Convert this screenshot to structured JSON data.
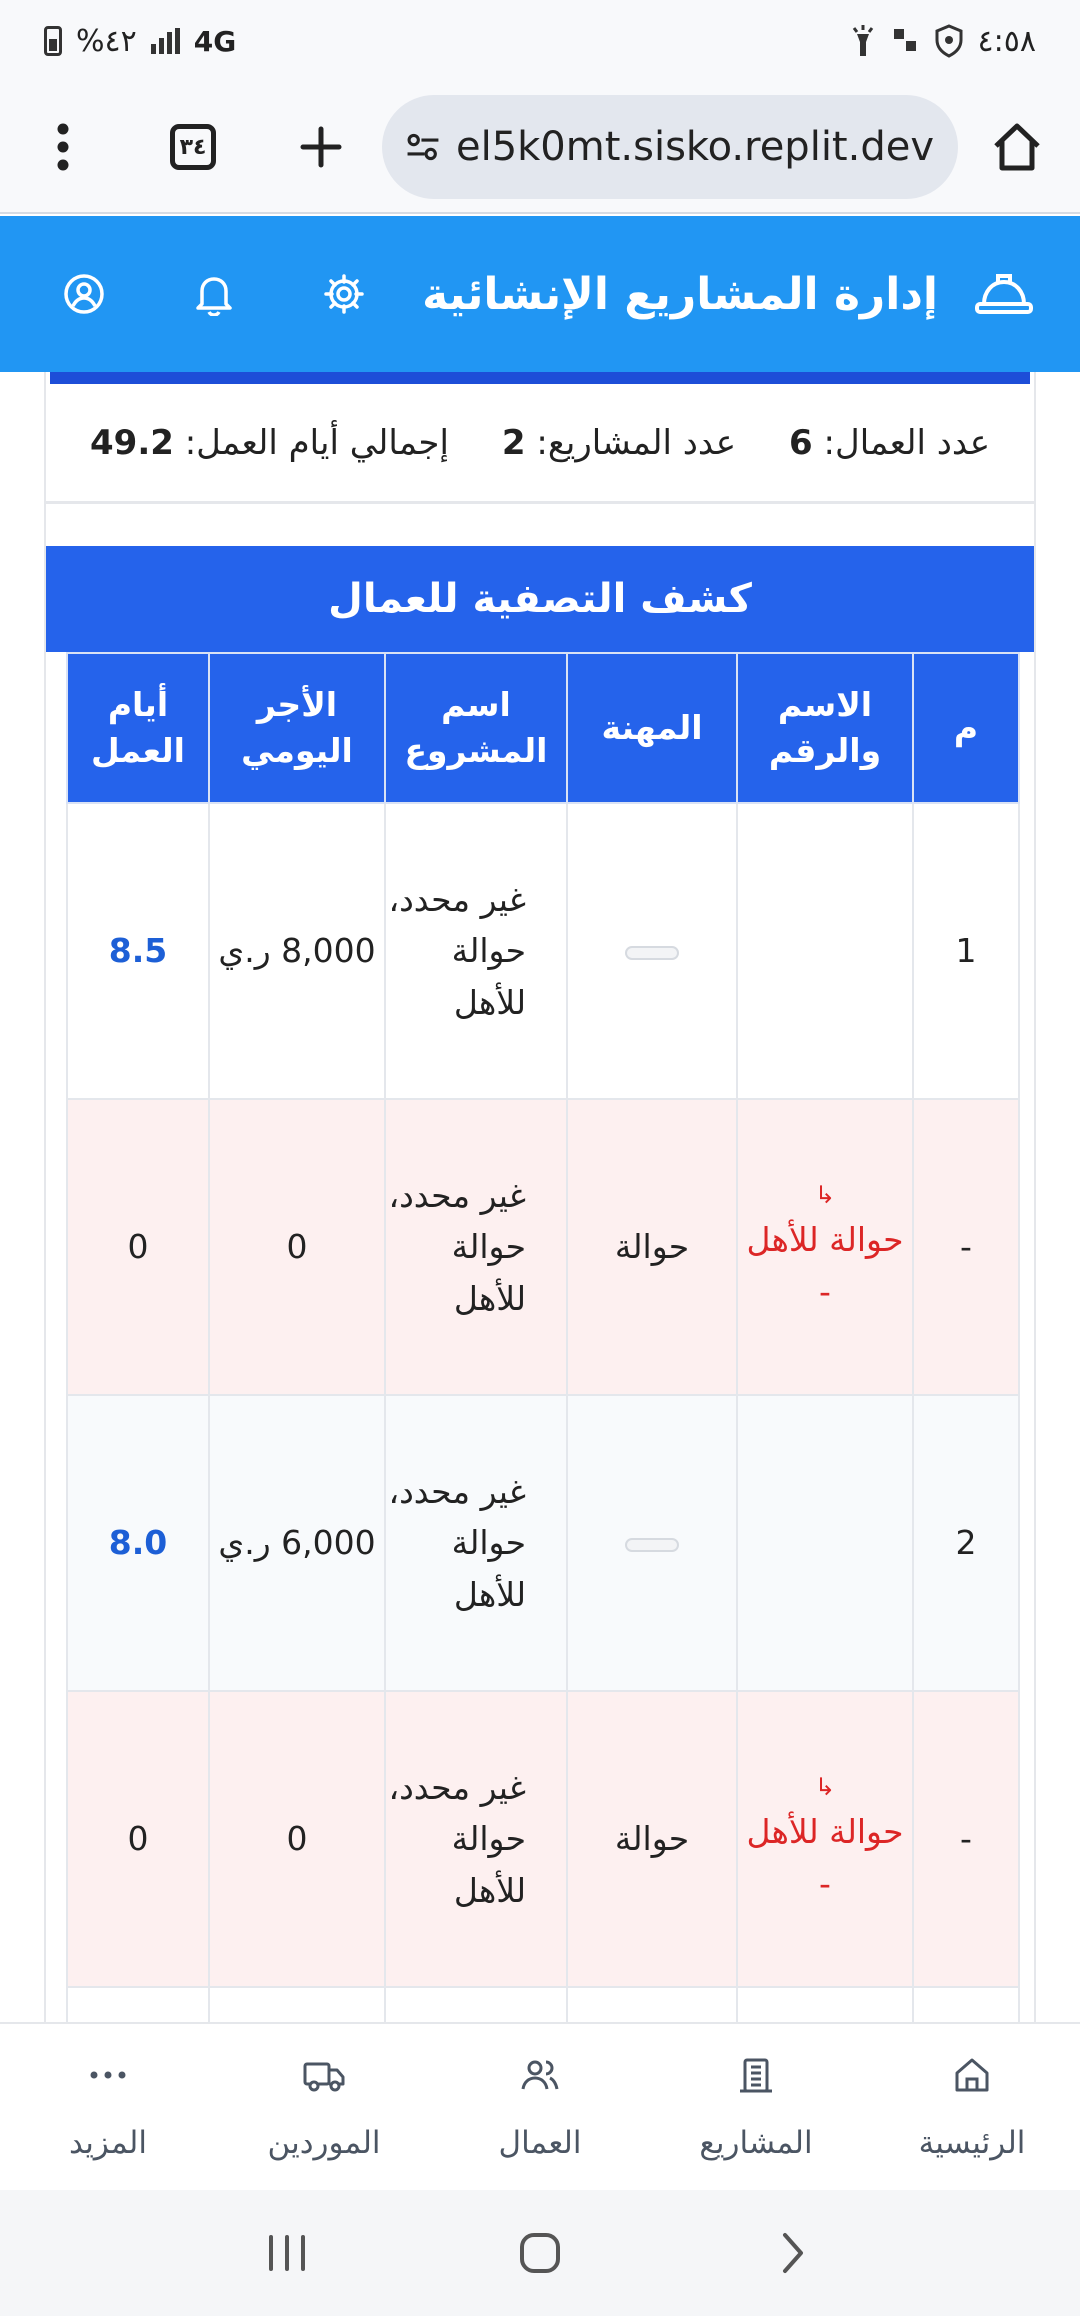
{
  "status_bar": {
    "time": "٤:٥٨",
    "battery": "%٤٢",
    "network": "4G"
  },
  "browser": {
    "url": "el5k0mt.sisko.replit.dev",
    "tab_count": "٣٤"
  },
  "header": {
    "title": "إدارة المشاريع الإنشائية",
    "brand_color": "#2196f3"
  },
  "summary": {
    "workers_label": "عدد العمال:",
    "workers_value": "6",
    "projects_label": "عدد المشاريع:",
    "projects_value": "2",
    "days_label": "إجمالي أيام العمل:",
    "days_value": "49.2"
  },
  "report": {
    "title": "كشف التصفية للعمال",
    "columns": [
      "م",
      "الاسم والرقم",
      "المهنة",
      "اسم المشروع",
      "الأجر اليومي",
      "أيام العمل"
    ],
    "rows": [
      {
        "num": "1",
        "name_arrow": "",
        "name": "",
        "name_suffix": "",
        "profession": "",
        "project": "غير محدد، حوالة للأهل",
        "wage": "8,000 ر.ي",
        "days": "8.5"
      },
      {
        "num": "-",
        "name_arrow": "↳",
        "name": "حوالة للأهل",
        "name_suffix": "-",
        "profession": "حوالة",
        "project": "غير محدد، حوالة للأهل",
        "wage": "0",
        "days": "0"
      },
      {
        "num": "2",
        "name_arrow": "",
        "name": "",
        "name_suffix": "",
        "profession": "",
        "project": "غير محدد، حوالة للأهل",
        "wage": "6,000 ر.ي",
        "days": "8.0"
      },
      {
        "num": "-",
        "name_arrow": "↳",
        "name": "حوالة للأهل",
        "name_suffix": "-",
        "profession": "حوالة",
        "project": "غير محدد، حوالة للأهل",
        "wage": "0",
        "days": "0"
      }
    ]
  },
  "bottom_nav": {
    "items": [
      {
        "label": "الرئيسية",
        "icon": "home-icon"
      },
      {
        "label": "المشاريع",
        "icon": "building-icon"
      },
      {
        "label": "العمال",
        "icon": "users-icon"
      },
      {
        "label": "الموردين",
        "icon": "truck-icon"
      },
      {
        "label": "المزيد",
        "icon": "more-icon"
      }
    ]
  }
}
